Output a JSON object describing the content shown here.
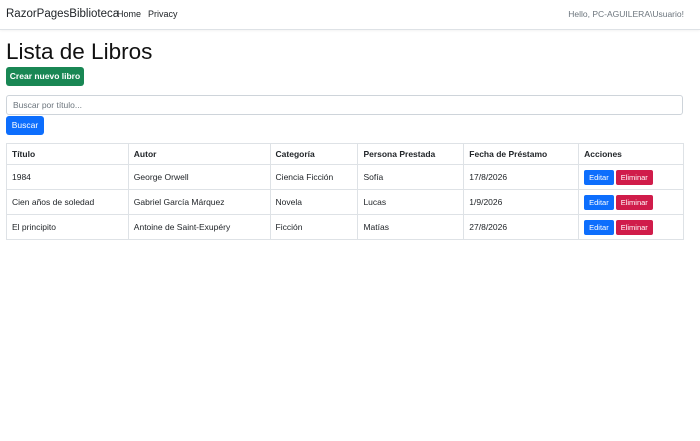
{
  "navbar": {
    "brand": "RazorPagesBiblioteca",
    "links": [
      "Home",
      "Privacy"
    ],
    "greeting": "Hello, PC-AGUILERA\\Usuario!"
  },
  "main": {
    "title": "Lista de Libros",
    "create_label": "Crear nuevo libro",
    "search": {
      "placeholder": "Buscar por título...",
      "value": "",
      "button_label": "Buscar"
    },
    "table": {
      "headers": [
        "Título",
        "Autor",
        "Categoría",
        "Persona Prestada",
        "Fecha de Préstamo",
        "Acciones"
      ],
      "rows": [
        [
          "1984",
          "George Orwell",
          "Ciencia Ficción",
          "Sofía",
          "17/8/2026"
        ],
        [
          "Cien años de soledad",
          "Gabriel García Márquez",
          "Novela",
          "Lucas",
          "1/9/2026"
        ],
        [
          "El principito",
          "Antoine de Saint-Exupéry",
          "Ficción",
          "Matías",
          "27/8/2026"
        ]
      ],
      "edit_label": "Editar",
      "delete_label": "Eliminar"
    }
  },
  "colors": {
    "create_button": "#198754",
    "primary_button": "#0d6efd",
    "delete_button": "#d01c4a",
    "border": "#dee2e6"
  }
}
